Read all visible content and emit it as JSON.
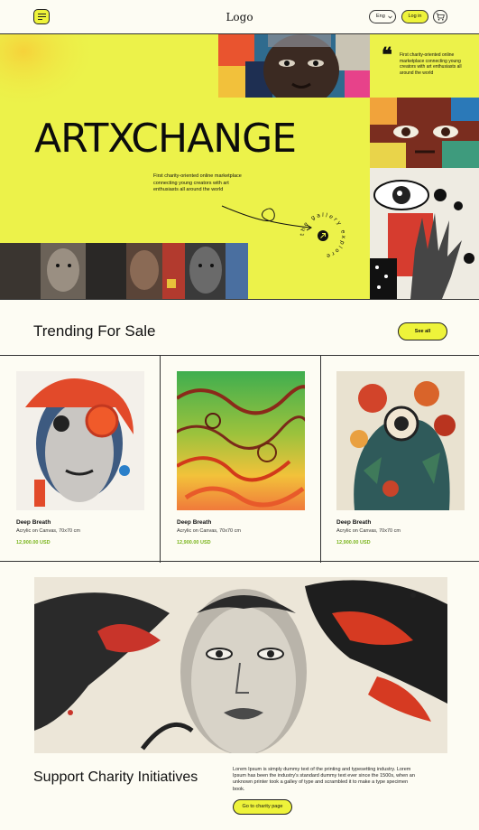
{
  "header": {
    "logo": "Logo",
    "language": "Eng",
    "login_label": "Log in"
  },
  "hero": {
    "title": "ARTXCHANGE",
    "description": "First charity-oriented online marketplace connecting young creators with art enthusiasts all around the world",
    "quote": "First charity-oriented online marketplace connecting young creators with art enthusiasts all around the world",
    "explore_badge": "the gallery explore"
  },
  "trending": {
    "title": "Trending For Sale",
    "see_all_label": "See all",
    "items": [
      {
        "name": "Deep Breath",
        "medium": "Acrylic on Canvas, 70x70 cm",
        "price": "12,900.00 USD"
      },
      {
        "name": "Deep Breath",
        "medium": "Acrylic on Canvas, 70x70 cm",
        "price": "12,900.00 USD"
      },
      {
        "name": "Deep Breath",
        "medium": "Acrylic on Canvas, 70x70 cm",
        "price": "12,900.00 USD"
      }
    ]
  },
  "support": {
    "title": "Support Charity Initiatives",
    "text": "Lorem Ipsum is simply dummy text of the printing and typesetting industry. Lorem Ipsum has been the industry's standard dummy text ever since the 1500s, when an unknown printer took a galley of type and scrambled it to make a type specimen book.",
    "button_label": "Go to charity page"
  },
  "colors": {
    "accent": "#eef33a",
    "hero_bg": "#ecf24a",
    "page_bg": "#fdfcf3",
    "price": "#7ab51d"
  }
}
